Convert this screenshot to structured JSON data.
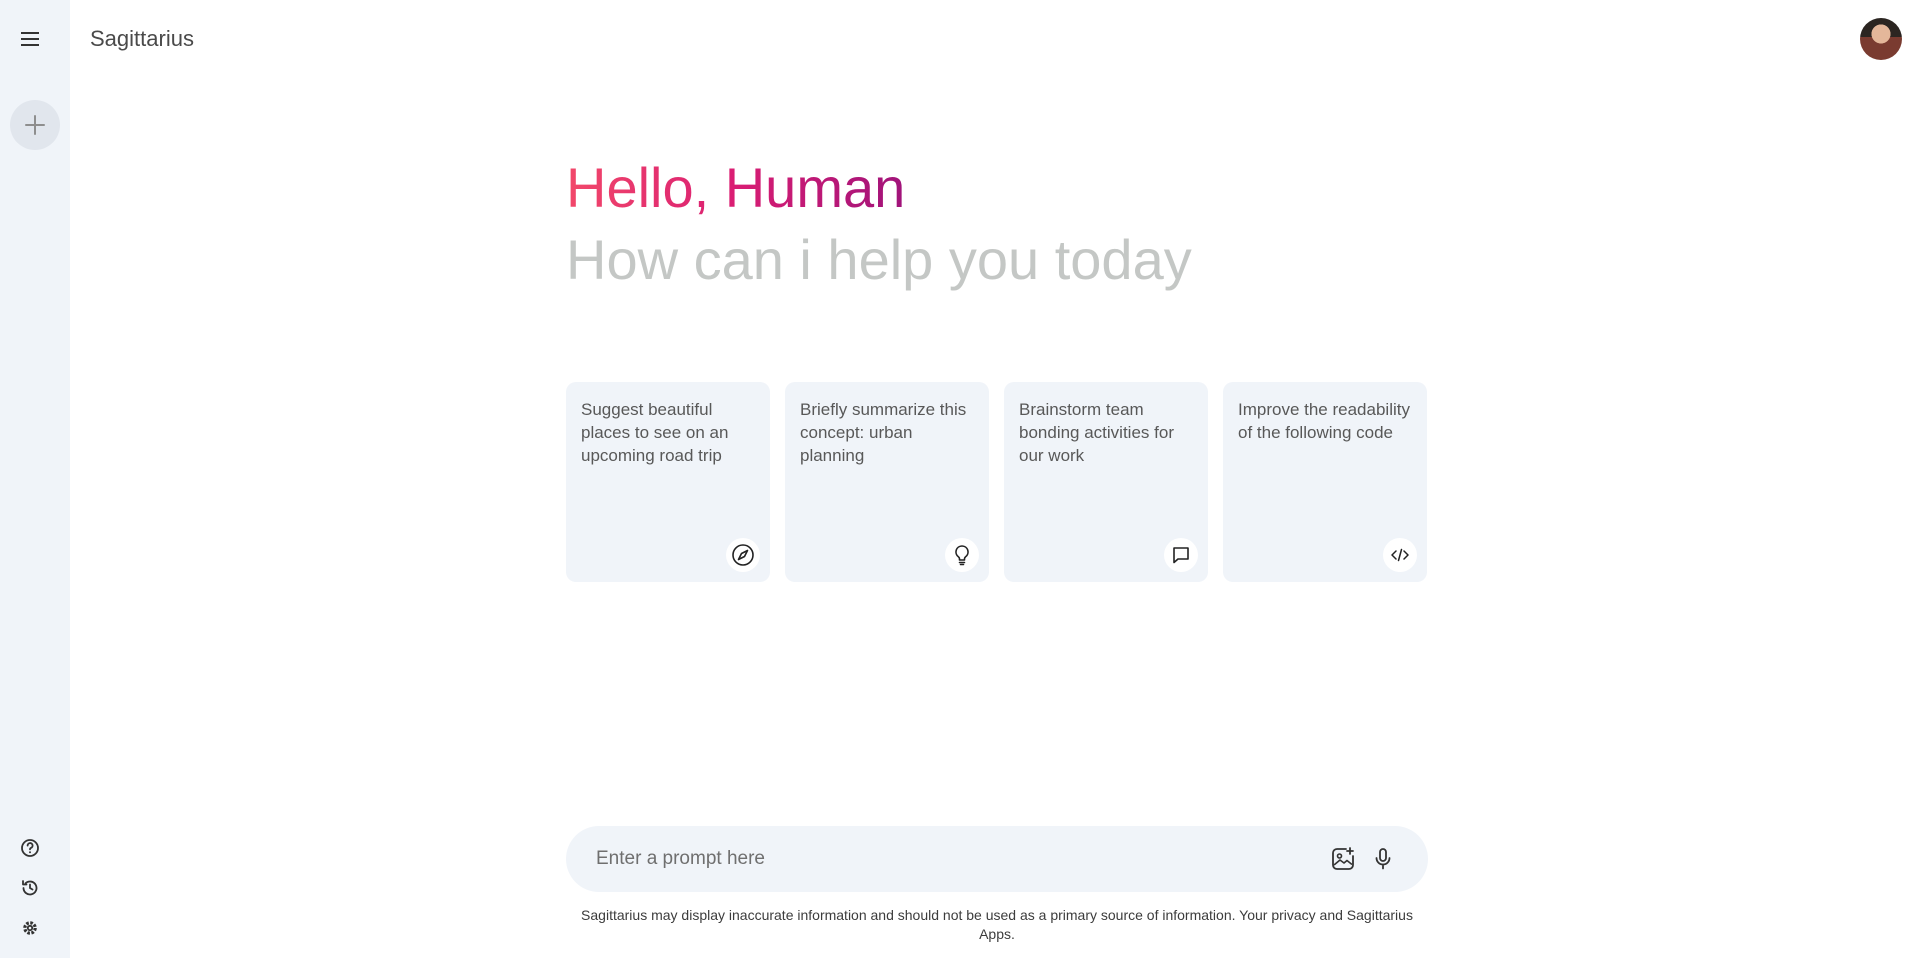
{
  "app": {
    "title": "Sagittarius"
  },
  "greeting": {
    "hello": "Hello, Human",
    "subtitle": "How can i help you today"
  },
  "cards": [
    {
      "text": "Suggest beautiful places to see on an upcoming road trip",
      "icon": "compass-icon"
    },
    {
      "text": "Briefly summarize this concept: urban planning",
      "icon": "bulb-icon"
    },
    {
      "text": "Brainstorm team bonding activities for our work",
      "icon": "message-icon"
    },
    {
      "text": "Improve the readability of the following code",
      "icon": "code-icon"
    }
  ],
  "prompt": {
    "placeholder": "Enter a prompt here"
  },
  "footer": {
    "disclaimer": "Sagittarius may display inaccurate information and should not be used as a primary source of information. Your privacy and Sagittarius Apps."
  },
  "colors": {
    "sidebar_bg": "#f0f4f9",
    "card_bg": "#f0f4f9",
    "gradient_start": "#f2486a",
    "gradient_end": "#a0137a",
    "subtitle": "#c4c7c5"
  }
}
